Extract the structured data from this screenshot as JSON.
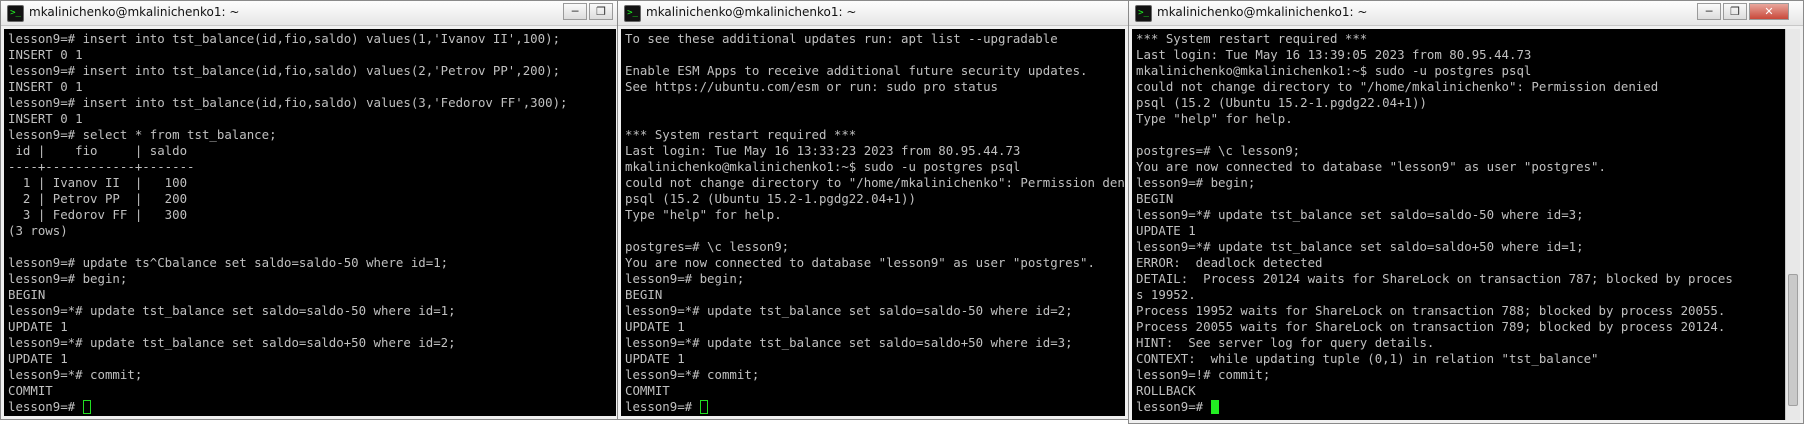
{
  "windows": [
    {
      "title": "mkalinichenko@mkalinichenko1: ~",
      "lines": [
        "lesson9=# insert into tst_balance(id,fio,saldo) values(1,'Ivanov II',100);",
        "INSERT 0 1",
        "lesson9=# insert into tst_balance(id,fio,saldo) values(2,'Petrov PP',200);",
        "INSERT 0 1",
        "lesson9=# insert into tst_balance(id,fio,saldo) values(3,'Fedorov FF',300);",
        "INSERT 0 1",
        "lesson9=# select * from tst_balance;",
        " id |    fio     | saldo",
        "----+------------+-------",
        "  1 | Ivanov II  |   100",
        "  2 | Petrov PP  |   200",
        "  3 | Fedorov FF |   300",
        "(3 rows)",
        "",
        "lesson9=# update ts^Cbalance set saldo=saldo-50 where id=1;",
        "lesson9=# begin;",
        "BEGIN",
        "lesson9=*# update tst_balance set saldo=saldo-50 where id=1;",
        "UPDATE 1",
        "lesson9=*# update tst_balance set saldo=saldo+50 where id=2;",
        "UPDATE 1",
        "lesson9=*# commit;",
        "COMMIT"
      ],
      "prompt": "lesson9=# "
    },
    {
      "title": "mkalinichenko@mkalinichenko1: ~",
      "lines": [
        "To see these additional updates run: apt list --upgradable",
        "",
        "Enable ESM Apps to receive additional future security updates.",
        "See https://ubuntu.com/esm or run: sudo pro status",
        "",
        "",
        "*** System restart required ***",
        "Last login: Tue May 16 13:33:23 2023 from 80.95.44.73",
        "mkalinichenko@mkalinichenko1:~$ sudo -u postgres psql",
        "could not change directory to \"/home/mkalinichenko\": Permission denied",
        "psql (15.2 (Ubuntu 15.2-1.pgdg22.04+1))",
        "Type \"help\" for help.",
        "",
        "postgres=# \\c lesson9;",
        "You are now connected to database \"lesson9\" as user \"postgres\".",
        "lesson9=# begin;",
        "BEGIN",
        "lesson9=*# update tst_balance set saldo=saldo-50 where id=2;",
        "UPDATE 1",
        "lesson9=*# update tst_balance set saldo=saldo+50 where id=3;",
        "UPDATE 1",
        "lesson9=*# commit;",
        "COMMIT"
      ],
      "prompt": "lesson9=# "
    },
    {
      "title": "mkalinichenko@mkalinichenko1: ~",
      "lines": [
        "*** System restart required ***",
        "Last login: Tue May 16 13:39:05 2023 from 80.95.44.73",
        "mkalinichenko@mkalinichenko1:~$ sudo -u postgres psql",
        "could not change directory to \"/home/mkalinichenko\": Permission denied",
        "psql (15.2 (Ubuntu 15.2-1.pgdg22.04+1))",
        "Type \"help\" for help.",
        "",
        "postgres=# \\c lesson9;",
        "You are now connected to database \"lesson9\" as user \"postgres\".",
        "lesson9=# begin;",
        "BEGIN",
        "lesson9=*# update tst_balance set saldo=saldo-50 where id=3;",
        "UPDATE 1",
        "lesson9=*# update tst_balance set saldo=saldo+50 where id=1;",
        "ERROR:  deadlock detected",
        "DETAIL:  Process 20124 waits for ShareLock on transaction 787; blocked by proces",
        "s 19952.",
        "Process 19952 waits for ShareLock on transaction 788; blocked by process 20055.",
        "Process 20055 waits for ShareLock on transaction 789; blocked by process 20124.",
        "HINT:  See server log for query details.",
        "CONTEXT:  while updating tuple (0,1) in relation \"tst_balance\"",
        "lesson9=!# commit;",
        "ROLLBACK"
      ],
      "prompt": "lesson9=# "
    }
  ],
  "controls": {
    "minimize": "─",
    "restore": "❐",
    "close": "✕"
  },
  "icons": {
    "app": "putty-terminal-icon"
  }
}
